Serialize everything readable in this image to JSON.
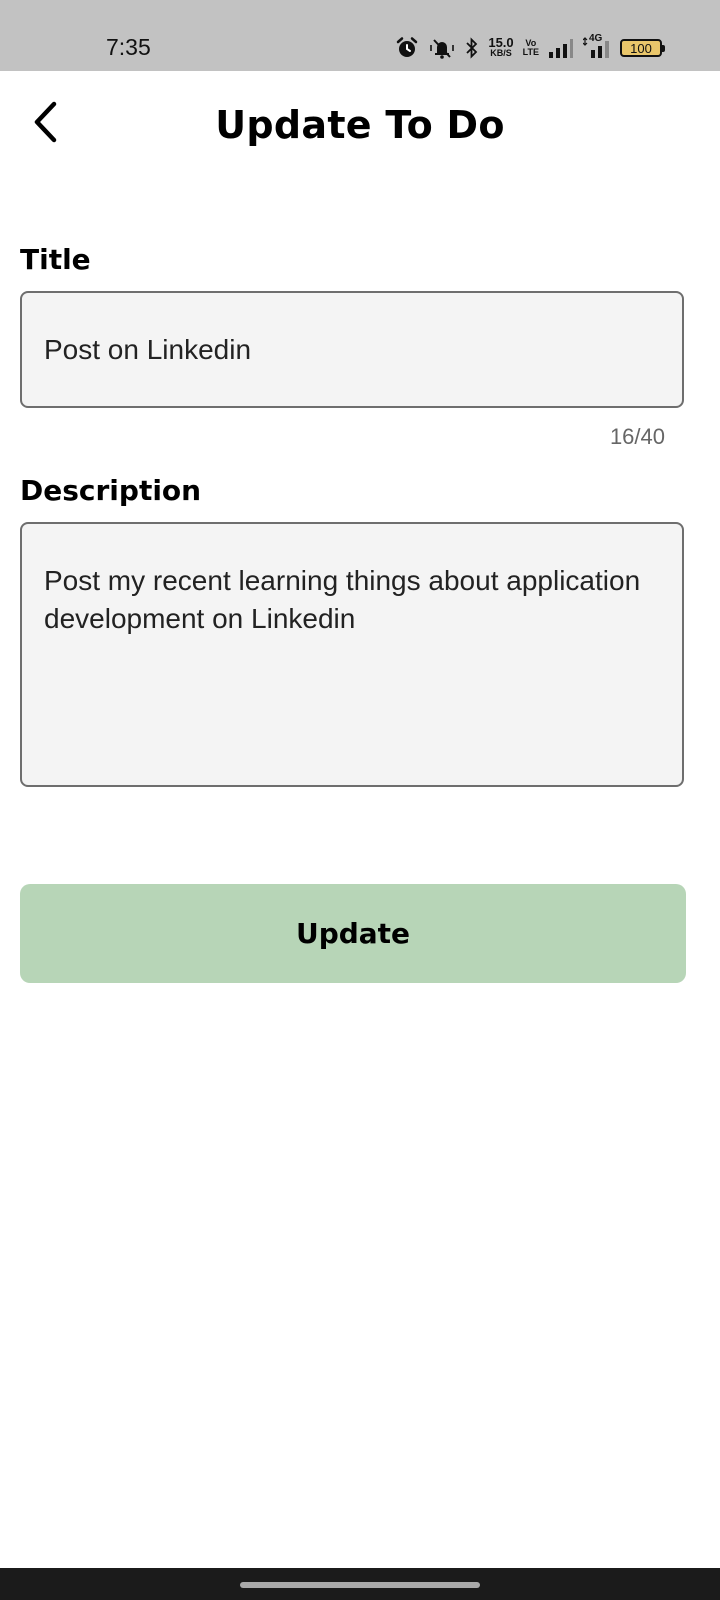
{
  "status_bar": {
    "time": "7:35",
    "net_speed_value": "15.0",
    "net_speed_unit": "KB/S",
    "volte_top": "Vo",
    "volte_bottom": "LTE",
    "network_type": "4G",
    "battery": "100",
    "icons": [
      "alarm-icon",
      "vibrate-icon",
      "bluetooth-icon",
      "signal-icon",
      "battery-icon"
    ]
  },
  "header": {
    "title": "Update To Do",
    "back_icon": "chevron-left-icon"
  },
  "form": {
    "title_label": "Title",
    "title_value": "Post on Linkedin",
    "title_counter": "16/40",
    "description_label": "Description",
    "description_value": "Post my recent learning things about application development on Linkedin"
  },
  "actions": {
    "update_label": "Update"
  },
  "colors": {
    "status_bar_bg": "#c2c2c2",
    "field_bg": "#f4f4f4",
    "field_border": "#6e6e6e",
    "button_bg": "#b7d5b7",
    "battery_fill": "#e9c66b"
  }
}
